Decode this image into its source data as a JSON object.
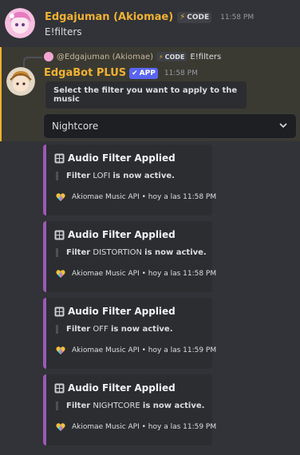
{
  "message1": {
    "author": "Edgajuman (Akiomae)",
    "author_color": "#f0b232",
    "badge": "CODE",
    "timestamp": "11:58 PM",
    "text": "E!filters"
  },
  "reply_preview": {
    "author": "@Edgajuman (Akiomae)",
    "badge": "CODE",
    "text": "E!filters"
  },
  "message2": {
    "author": "EdgaBot PLUS",
    "author_color": "#f0b232",
    "badge": "APP",
    "timestamp": "11:58 PM",
    "prompt": "Select the filter you want to apply to the music",
    "select_value": "Nightcore"
  },
  "embeds": [
    {
      "title": "Audio Filter Applied",
      "prefix": "Filter",
      "filter": "LOFI",
      "suffix": "is now active.",
      "footer": "Akiomae Music API • hoy a las 11:58 PM"
    },
    {
      "title": "Audio Filter Applied",
      "prefix": "Filter",
      "filter": "DISTORTION",
      "suffix": "is now active.",
      "footer": "Akiomae Music API • hoy a las 11:58 PM"
    },
    {
      "title": "Audio Filter Applied",
      "prefix": "Filter",
      "filter": "OFF",
      "suffix": "is now active.",
      "footer": "Akiomae Music API • hoy a las 11:59 PM"
    },
    {
      "title": "Audio Filter Applied",
      "prefix": "Filter",
      "filter": "NIGHTCORE",
      "suffix": "is now active.",
      "footer": "Akiomae Music API • hoy a las 11:59 PM"
    }
  ],
  "colors": {
    "embed_accent": "#9b59b6",
    "app_badge": "#5865f2",
    "highlight_bar": "#f0b232"
  },
  "icons": {
    "badge_code": "lightning-icon",
    "app_badge": "checkmark-icon",
    "embed_title": "control-knobs-icon",
    "embed_footer": "heart-icon",
    "select": "chevron-down-icon"
  }
}
